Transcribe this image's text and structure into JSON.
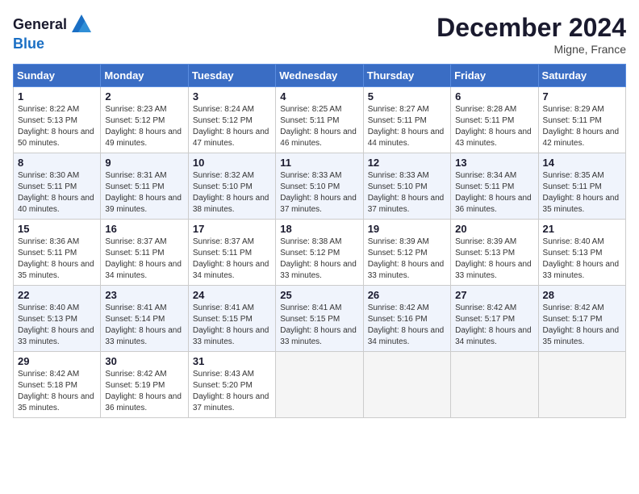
{
  "logo": {
    "general": "General",
    "blue": "Blue"
  },
  "title": "December 2024",
  "location": "Migne, France",
  "days_of_week": [
    "Sunday",
    "Monday",
    "Tuesday",
    "Wednesday",
    "Thursday",
    "Friday",
    "Saturday"
  ],
  "weeks": [
    [
      {
        "num": "1",
        "sunrise": "Sunrise: 8:22 AM",
        "sunset": "Sunset: 5:13 PM",
        "daylight": "Daylight: 8 hours and 50 minutes."
      },
      {
        "num": "2",
        "sunrise": "Sunrise: 8:23 AM",
        "sunset": "Sunset: 5:12 PM",
        "daylight": "Daylight: 8 hours and 49 minutes."
      },
      {
        "num": "3",
        "sunrise": "Sunrise: 8:24 AM",
        "sunset": "Sunset: 5:12 PM",
        "daylight": "Daylight: 8 hours and 47 minutes."
      },
      {
        "num": "4",
        "sunrise": "Sunrise: 8:25 AM",
        "sunset": "Sunset: 5:11 PM",
        "daylight": "Daylight: 8 hours and 46 minutes."
      },
      {
        "num": "5",
        "sunrise": "Sunrise: 8:27 AM",
        "sunset": "Sunset: 5:11 PM",
        "daylight": "Daylight: 8 hours and 44 minutes."
      },
      {
        "num": "6",
        "sunrise": "Sunrise: 8:28 AM",
        "sunset": "Sunset: 5:11 PM",
        "daylight": "Daylight: 8 hours and 43 minutes."
      },
      {
        "num": "7",
        "sunrise": "Sunrise: 8:29 AM",
        "sunset": "Sunset: 5:11 PM",
        "daylight": "Daylight: 8 hours and 42 minutes."
      }
    ],
    [
      {
        "num": "8",
        "sunrise": "Sunrise: 8:30 AM",
        "sunset": "Sunset: 5:11 PM",
        "daylight": "Daylight: 8 hours and 40 minutes."
      },
      {
        "num": "9",
        "sunrise": "Sunrise: 8:31 AM",
        "sunset": "Sunset: 5:11 PM",
        "daylight": "Daylight: 8 hours and 39 minutes."
      },
      {
        "num": "10",
        "sunrise": "Sunrise: 8:32 AM",
        "sunset": "Sunset: 5:10 PM",
        "daylight": "Daylight: 8 hours and 38 minutes."
      },
      {
        "num": "11",
        "sunrise": "Sunrise: 8:33 AM",
        "sunset": "Sunset: 5:10 PM",
        "daylight": "Daylight: 8 hours and 37 minutes."
      },
      {
        "num": "12",
        "sunrise": "Sunrise: 8:33 AM",
        "sunset": "Sunset: 5:10 PM",
        "daylight": "Daylight: 8 hours and 37 minutes."
      },
      {
        "num": "13",
        "sunrise": "Sunrise: 8:34 AM",
        "sunset": "Sunset: 5:11 PM",
        "daylight": "Daylight: 8 hours and 36 minutes."
      },
      {
        "num": "14",
        "sunrise": "Sunrise: 8:35 AM",
        "sunset": "Sunset: 5:11 PM",
        "daylight": "Daylight: 8 hours and 35 minutes."
      }
    ],
    [
      {
        "num": "15",
        "sunrise": "Sunrise: 8:36 AM",
        "sunset": "Sunset: 5:11 PM",
        "daylight": "Daylight: 8 hours and 35 minutes."
      },
      {
        "num": "16",
        "sunrise": "Sunrise: 8:37 AM",
        "sunset": "Sunset: 5:11 PM",
        "daylight": "Daylight: 8 hours and 34 minutes."
      },
      {
        "num": "17",
        "sunrise": "Sunrise: 8:37 AM",
        "sunset": "Sunset: 5:11 PM",
        "daylight": "Daylight: 8 hours and 34 minutes."
      },
      {
        "num": "18",
        "sunrise": "Sunrise: 8:38 AM",
        "sunset": "Sunset: 5:12 PM",
        "daylight": "Daylight: 8 hours and 33 minutes."
      },
      {
        "num": "19",
        "sunrise": "Sunrise: 8:39 AM",
        "sunset": "Sunset: 5:12 PM",
        "daylight": "Daylight: 8 hours and 33 minutes."
      },
      {
        "num": "20",
        "sunrise": "Sunrise: 8:39 AM",
        "sunset": "Sunset: 5:13 PM",
        "daylight": "Daylight: 8 hours and 33 minutes."
      },
      {
        "num": "21",
        "sunrise": "Sunrise: 8:40 AM",
        "sunset": "Sunset: 5:13 PM",
        "daylight": "Daylight: 8 hours and 33 minutes."
      }
    ],
    [
      {
        "num": "22",
        "sunrise": "Sunrise: 8:40 AM",
        "sunset": "Sunset: 5:13 PM",
        "daylight": "Daylight: 8 hours and 33 minutes."
      },
      {
        "num": "23",
        "sunrise": "Sunrise: 8:41 AM",
        "sunset": "Sunset: 5:14 PM",
        "daylight": "Daylight: 8 hours and 33 minutes."
      },
      {
        "num": "24",
        "sunrise": "Sunrise: 8:41 AM",
        "sunset": "Sunset: 5:15 PM",
        "daylight": "Daylight: 8 hours and 33 minutes."
      },
      {
        "num": "25",
        "sunrise": "Sunrise: 8:41 AM",
        "sunset": "Sunset: 5:15 PM",
        "daylight": "Daylight: 8 hours and 33 minutes."
      },
      {
        "num": "26",
        "sunrise": "Sunrise: 8:42 AM",
        "sunset": "Sunset: 5:16 PM",
        "daylight": "Daylight: 8 hours and 34 minutes."
      },
      {
        "num": "27",
        "sunrise": "Sunrise: 8:42 AM",
        "sunset": "Sunset: 5:17 PM",
        "daylight": "Daylight: 8 hours and 34 minutes."
      },
      {
        "num": "28",
        "sunrise": "Sunrise: 8:42 AM",
        "sunset": "Sunset: 5:17 PM",
        "daylight": "Daylight: 8 hours and 35 minutes."
      }
    ],
    [
      {
        "num": "29",
        "sunrise": "Sunrise: 8:42 AM",
        "sunset": "Sunset: 5:18 PM",
        "daylight": "Daylight: 8 hours and 35 minutes."
      },
      {
        "num": "30",
        "sunrise": "Sunrise: 8:42 AM",
        "sunset": "Sunset: 5:19 PM",
        "daylight": "Daylight: 8 hours and 36 minutes."
      },
      {
        "num": "31",
        "sunrise": "Sunrise: 8:43 AM",
        "sunset": "Sunset: 5:20 PM",
        "daylight": "Daylight: 8 hours and 37 minutes."
      },
      null,
      null,
      null,
      null
    ]
  ]
}
